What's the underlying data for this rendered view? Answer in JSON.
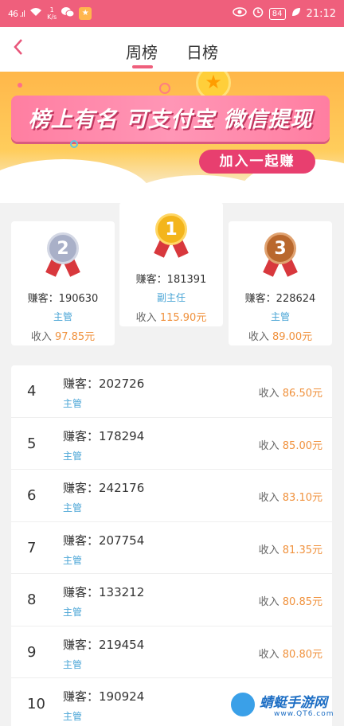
{
  "status_bar": {
    "signal": "46 .ıl",
    "net_speed_top": "1",
    "net_speed_bottom": "K/s",
    "battery": "84",
    "time": "21:12"
  },
  "nav": {
    "tab_week": "周榜",
    "tab_day": "日榜"
  },
  "banner": {
    "slogan": "榜上有名 可支付宝 微信提现",
    "join_button": "加入一起赚"
  },
  "podium": [
    {
      "rank": "2",
      "name": "赚客：190630",
      "role": "主管",
      "income_label": "收入",
      "income": "97.85元",
      "color": "#a9b0c8"
    },
    {
      "rank": "1",
      "name": "赚客：181391",
      "role": "副主任",
      "income_label": "收入",
      "income": "115.90元",
      "color": "#f3b51c"
    },
    {
      "rank": "3",
      "name": "赚客：228624",
      "role": "主管",
      "income_label": "收入",
      "income": "89.00元",
      "color": "#b9682d"
    }
  ],
  "list": [
    {
      "rank": "4",
      "name": "赚客：202726",
      "role": "主管",
      "income_label": "收入",
      "income": "86.50元"
    },
    {
      "rank": "5",
      "name": "赚客：178294",
      "role": "主管",
      "income_label": "收入",
      "income": "85.00元"
    },
    {
      "rank": "6",
      "name": "赚客：242176",
      "role": "主管",
      "income_label": "收入",
      "income": "83.10元"
    },
    {
      "rank": "7",
      "name": "赚客：207754",
      "role": "主管",
      "income_label": "收入",
      "income": "81.35元"
    },
    {
      "rank": "8",
      "name": "赚客：133212",
      "role": "主管",
      "income_label": "收入",
      "income": "80.85元"
    },
    {
      "rank": "9",
      "name": "赚客：219454",
      "role": "主管",
      "income_label": "收入",
      "income": "80.80元"
    },
    {
      "rank": "10",
      "name": "赚客：190924",
      "role": "主管",
      "income_label": "收入",
      "income": ""
    }
  ],
  "watermark": {
    "title": "蜻蜓手游网",
    "sub": "www.QT6.com"
  },
  "colors": {
    "accent": "#ef5f7c",
    "amount": "#f0913c",
    "role": "#4aa5d6"
  }
}
